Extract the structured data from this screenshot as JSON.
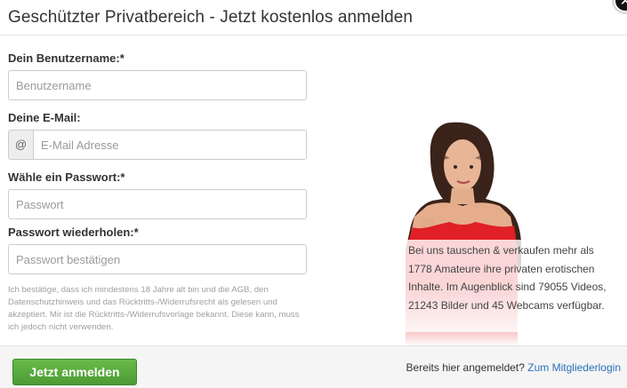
{
  "modal": {
    "title": "Geschützter Privatbereich - Jetzt kostenlos anmelden",
    "close_icon": "close-icon"
  },
  "form": {
    "username": {
      "label": "Dein Benutzername:*",
      "placeholder": "Benutzername",
      "value": ""
    },
    "email": {
      "label": "Deine E-Mail:",
      "addon": "@",
      "placeholder": "E-Mail Adresse",
      "value": ""
    },
    "password": {
      "label": "Wähle ein Passwort:*",
      "placeholder": "Passwort",
      "value": ""
    },
    "password_repeat": {
      "label": "Passwort wiederholen:*",
      "placeholder": "Passwort bestätigen",
      "value": ""
    },
    "terms": "Ich bestätige, dass ich mindestens 18 Jahre alt bin und die AGB, den Datenschutzhinweis und das Rücktritts-/Widerrufsrecht als gelesen und akzeptiert. Mir ist die Rücktritts-/Widerrufsvorlage bekannt. Diese kann, muss ich jedoch nicht verwenden."
  },
  "promo": {
    "text_1": "Bei uns tauschen & verkaufen mehr als ",
    "amateurs": "1778",
    "text_2": " Amateure ihre privaten erotischen Inhalte. Im Augenblick sind ",
    "videos": "79055",
    "text_3": " Videos, ",
    "images": "21243",
    "text_4": " Bilder und ",
    "webcams": "45",
    "text_5": " Webcams verfügbar."
  },
  "footer": {
    "submit_label": "Jetzt anmelden",
    "already_text": "Bereits hier angemeldet?",
    "login_link": "Zum Mitgliederlogin"
  },
  "colors": {
    "submit_green": "#59aa3d",
    "link_blue": "#2a6fba",
    "promo_red": "#e01f26"
  }
}
